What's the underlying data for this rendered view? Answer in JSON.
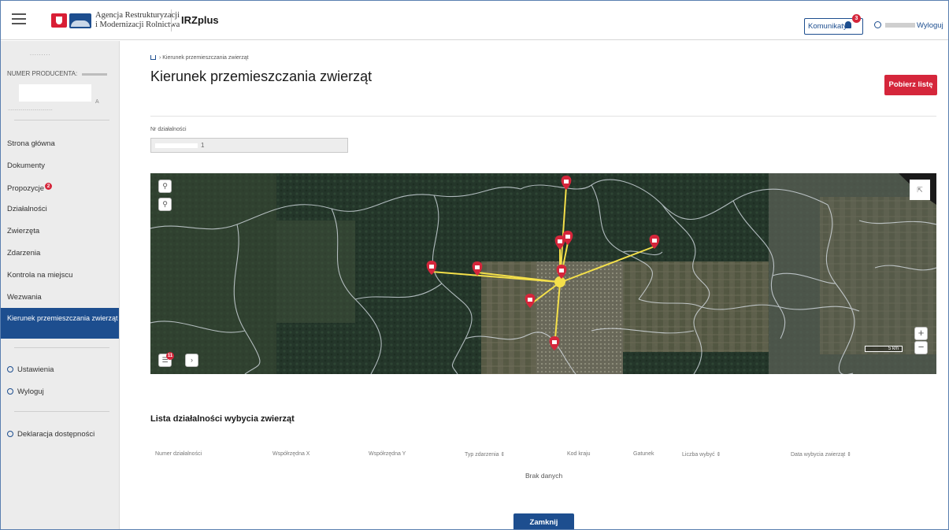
{
  "header": {
    "agency_line1": "Agencja Restrukturyzacji",
    "agency_line2": "i Modernizacji Rolnictwa",
    "app_name": "IRZplus",
    "komunikaty_label": "Komunikaty",
    "komunikaty_count": "3",
    "logout_label": "Wyloguj"
  },
  "sidebar": {
    "producer_number_label": "NUMER PRODUCENTA:",
    "producer_address_tail": "A",
    "nav": [
      {
        "label": "Strona główna"
      },
      {
        "label": "Dokumenty"
      },
      {
        "label": "Propozycje",
        "badge": "2"
      },
      {
        "label": "Działalności"
      },
      {
        "label": "Zwierzęta"
      },
      {
        "label": "Zdarzenia"
      },
      {
        "label": "Kontrola na miejscu"
      },
      {
        "label": "Wezwania"
      },
      {
        "label": "Kierunek przemieszczania zwierząt",
        "active": true
      }
    ],
    "links": {
      "settings": "Ustawienia",
      "logout": "Wyloguj",
      "accessibility": "Deklaracja dostępności"
    }
  },
  "main": {
    "breadcrumb": "Kierunek przemieszczania zwierząt",
    "title": "Kierunek przemieszczania zwierząt",
    "download_button": "Pobierz listę",
    "field_label": "Nr działalności",
    "field_value_suffix": "1"
  },
  "map": {
    "zoom_in": "+",
    "zoom_out": "−",
    "scale_label": "5 km",
    "layers_badge": "11",
    "icons": [
      "search-icon",
      "search-icon",
      "fullscreen-icon",
      "layers-icon",
      "chevron-right-icon"
    ]
  },
  "list": {
    "title": "Lista działalności wybycia zwierząt",
    "columns": [
      "Numer działalności",
      "Współrzędna X",
      "Współrzędna Y",
      "Typ zdarzenia",
      "Kod kraju",
      "Gatunek",
      "Liczba wybyć",
      "Data wybycia zwierząt"
    ],
    "empty_text": "Brak danych",
    "close_button": "Zamknij"
  },
  "colors": {
    "brand_blue": "#1d4e8f",
    "accent_red": "#d5263b",
    "route_yellow": "#f4e04a"
  }
}
